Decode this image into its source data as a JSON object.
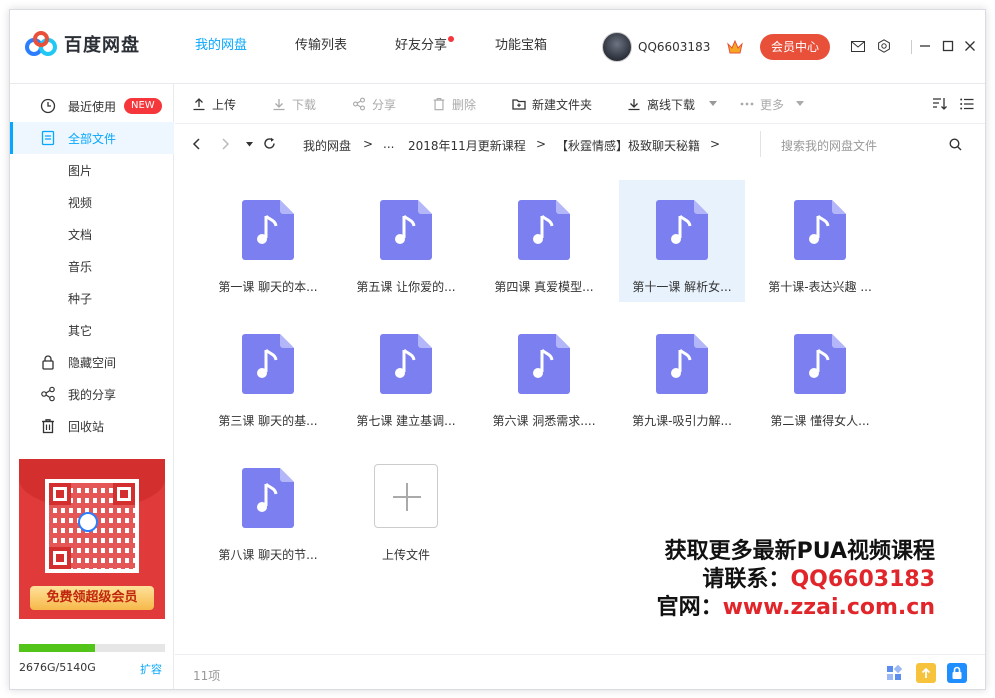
{
  "app": {
    "logo_text": "百度网盘",
    "nav": [
      "我的网盘",
      "传输列表",
      "好友分享",
      "功能宝箱"
    ],
    "active_nav": "我的网盘",
    "username": "QQ6603183",
    "vip_label": "会员中心",
    "brand_color": "#06a7ff"
  },
  "sidebar": {
    "items": [
      {
        "label": "最近使用",
        "icon": "clock-icon",
        "badge": "NEW"
      },
      {
        "label": "全部文件",
        "icon": "file-icon",
        "active": true
      },
      {
        "label": "图片"
      },
      {
        "label": "视频"
      },
      {
        "label": "文档"
      },
      {
        "label": "音乐"
      },
      {
        "label": "种子"
      },
      {
        "label": "其它"
      },
      {
        "label": "隐藏空间",
        "icon": "lock-icon"
      },
      {
        "label": "我的分享",
        "icon": "share-icon"
      },
      {
        "label": "回收站",
        "icon": "trash-icon"
      }
    ],
    "promo_label": "免费领超级会员",
    "storage": {
      "text": "2676G/5140G",
      "used_fraction": 0.52,
      "expand_label": "扩容"
    }
  },
  "toolbar": {
    "upload": "上传",
    "download": "下载",
    "share": "分享",
    "delete": "删除",
    "new_folder": "新建文件夹",
    "offline_download": "离线下载",
    "more": "更多"
  },
  "breadcrumb": {
    "items": [
      "我的网盘",
      ">",
      "...",
      "2018年11月更新课程",
      ">",
      "【秋霆情感】极致聊天秘籍",
      ">"
    ],
    "search_placeholder": "搜索我的网盘文件"
  },
  "files": [
    {
      "name": "第一课 聊天的本..."
    },
    {
      "name": "第五课 让你爱的..."
    },
    {
      "name": "第四课 真爱模型..."
    },
    {
      "name": "第十一课 解析女...",
      "selected": true
    },
    {
      "name": "第十课-表达兴趣 ..."
    },
    {
      "name": "第三课 聊天的基..."
    },
    {
      "name": "第七课 建立基调..."
    },
    {
      "name": "第六课 洞悉需求...."
    },
    {
      "name": "第九课-吸引力解..."
    },
    {
      "name": "第二课 懂得女人..."
    },
    {
      "name": "第八课 聊天的节..."
    }
  ],
  "upload_tile_label": "上传文件",
  "watermark": {
    "line1": "获取更多最新PUA视频课程",
    "line2_label": "请联系：",
    "line2_value": "QQ6603183",
    "line3_label": "官网：",
    "line3_value": "www.zzai.com.cn"
  },
  "footer": {
    "count": "11项"
  }
}
